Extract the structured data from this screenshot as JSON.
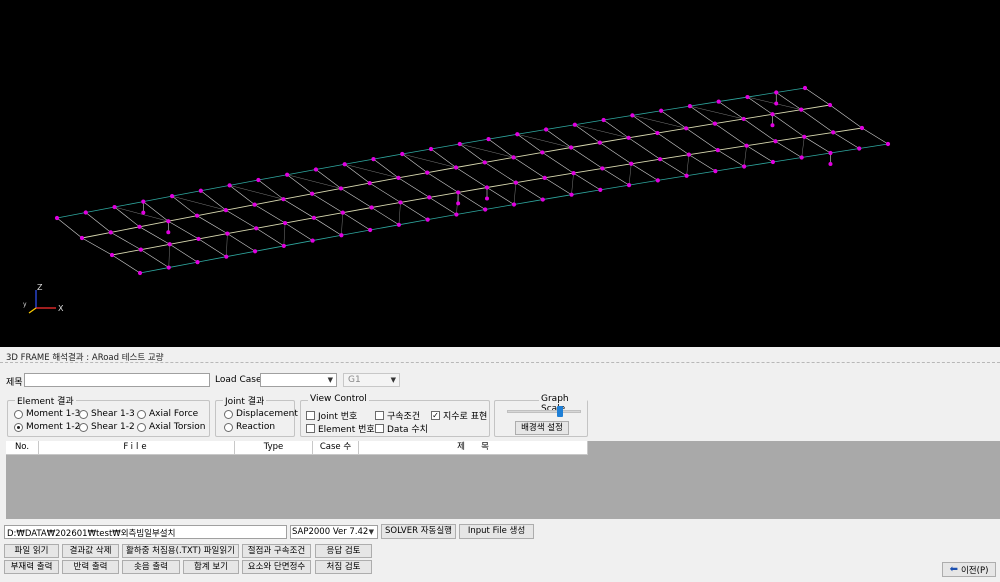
{
  "viewport": {
    "background": "#000000",
    "node_color": "#e000e0",
    "beam_color": "#d8d8b0",
    "edge_color": "#2fa8a0",
    "axes": {
      "z": "Z",
      "x": "X"
    }
  },
  "window_title": "3D FRAME 해석결과 : ARoad 테스트 교량",
  "form": {
    "title_label": "제목",
    "title_value": "",
    "load_case_label": "Load Case",
    "load_case_value": "",
    "g_value": "G1"
  },
  "element_result": {
    "legend": "Element 결과",
    "options": [
      "Moment 1-3",
      "Shear 1-3",
      "Axial Force",
      "Moment 1-2",
      "Shear 1-2",
      "Axial Torsion"
    ],
    "selected": "Moment 1-2"
  },
  "joint_result": {
    "legend": "Joint 결과",
    "options": [
      "Displacement",
      "Reaction"
    ]
  },
  "view_control": {
    "legend": "View Control",
    "items": [
      "Joint 번호",
      "구속조건",
      "지수로 표현",
      "Element 번호",
      "Data 수치"
    ],
    "checked": [
      "지수로 표현"
    ]
  },
  "graph_scale": {
    "legend": "Graph Scale",
    "level": 0.72,
    "bg_button": "배경색 설정"
  },
  "table": {
    "columns": [
      "No.",
      "File",
      "Type",
      "Case 수",
      "제      목"
    ],
    "rows": []
  },
  "bottom": {
    "path": "D:₩DATA₩202601₩test₩외측빔일부설치",
    "sap_version": "SAP2000 Ver 7.42",
    "solver_button": "SOLVER 자동실행",
    "input_file_button": "Input File 생성",
    "row1": [
      "파일 읽기",
      "결과값 삭제",
      "활하중 처짐용(.TXT) 파일읽기",
      "절점과 구속조건",
      "응답 검토"
    ],
    "row2": [
      "부재력 출력",
      "반력 출력",
      "솟음 출력",
      "합계 보기",
      "요소와 단면정수",
      "처짐 검토"
    ],
    "prev_button": "이전(P)"
  }
}
